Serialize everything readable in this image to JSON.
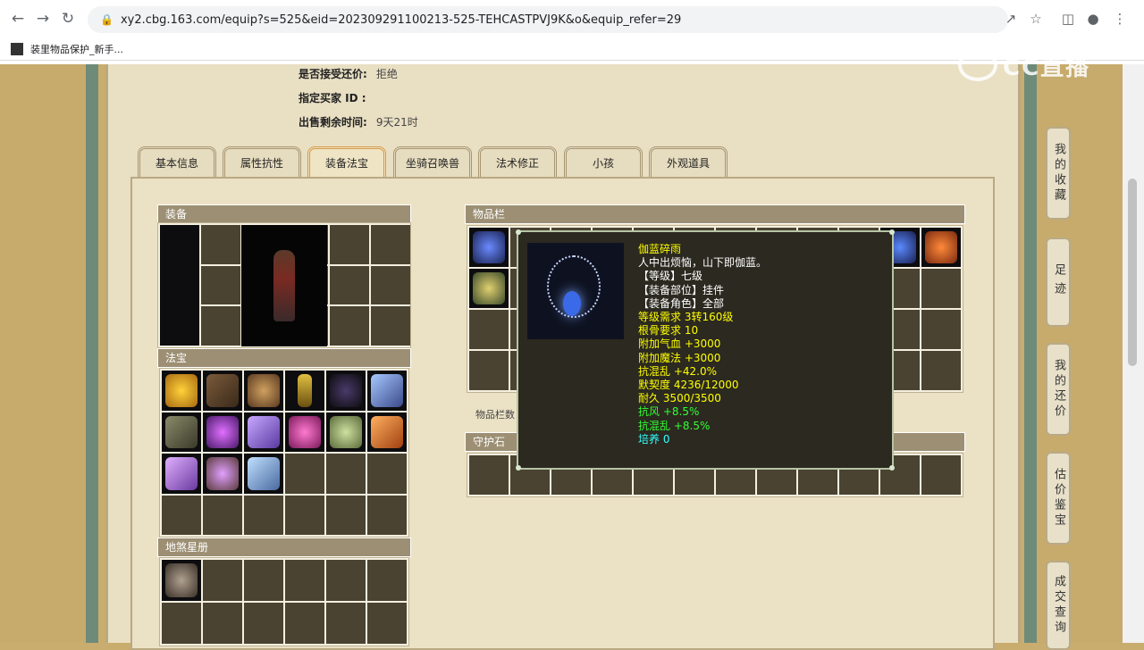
{
  "browser": {
    "url": "xy2.cbg.163.com/equip?s=525&eid=202309291100213-525-TEHCASTPVJ9K&o&equip_refer=29",
    "bookmark_label": "装里物品保护_新手..."
  },
  "watermark": {
    "text": "CC直播"
  },
  "info": {
    "accept_offer_label": "是否接受还价:",
    "accept_offer_value": "拒绝",
    "buyer_label": "指定买家 ID :",
    "buyer_value": "",
    "time_left_label": "出售剩余时间:",
    "time_left_value": "9天21时"
  },
  "tabs": [
    "基本信息",
    "属性抗性",
    "装备法宝",
    "坐骑召唤兽",
    "法术修正",
    "小孩",
    "外观道具"
  ],
  "active_tab": "装备法宝",
  "sections": {
    "equip": "装备",
    "fabao": "法宝",
    "disha": "地煞星册",
    "inventory": "物品栏",
    "inventory_note": "物品栏数",
    "guard_stone": "守护石"
  },
  "side_buttons": [
    {
      "label": "我的收藏"
    },
    {
      "label": "足迹"
    },
    {
      "label": "我的还价"
    },
    {
      "label": "估价鉴宝"
    },
    {
      "label": "成交查询"
    }
  ],
  "tooltip": {
    "name": "伽蓝碎雨",
    "desc": "人中出烦恼，山下即伽蓝。",
    "level": "【等级】七级",
    "slot": "【装备部位】挂件",
    "role": "【装备角色】全部",
    "req": "等级需求 3转160级",
    "gengu": "根骨要求 10",
    "hp": "附加气血 +3000",
    "mp": "附加魔法 +3000",
    "kangluan1": "抗混乱 +42.0%",
    "moqi": "默契度 4236/12000",
    "naijiu": "耐久 3500/3500",
    "kangfeng": "抗风 +8.5%",
    "kangluan2": "抗混乱 +8.5%",
    "peiyang": "培养 0"
  }
}
